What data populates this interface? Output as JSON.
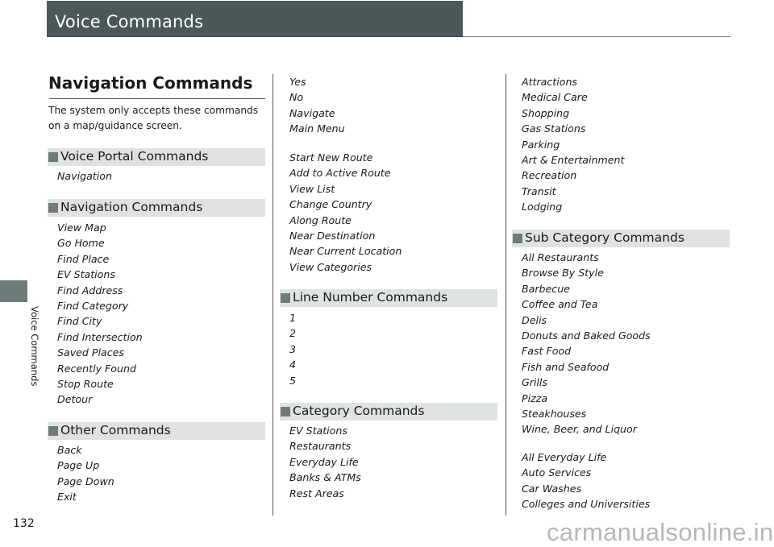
{
  "header": {
    "title": "Voice Commands"
  },
  "side_tab": {
    "label": "Voice Commands"
  },
  "page_number": "132",
  "main": {
    "heading": "Navigation Commands",
    "intro": "The system only accepts these commands on a map/guidance screen."
  },
  "sections": {
    "voice_portal": {
      "title": "Voice Portal Commands",
      "items": [
        "Navigation"
      ]
    },
    "navigation": {
      "title": "Navigation Commands",
      "items": [
        "View Map",
        "Go Home",
        "Find Place",
        "EV Stations",
        "Find Address",
        "Find Category",
        "Find City",
        "Find Intersection",
        "Saved Places",
        "Recently Found",
        "Stop Route",
        "Detour"
      ]
    },
    "other": {
      "title": "Other Commands",
      "items": [
        "Back",
        "Page Up",
        "Page Down",
        "Exit"
      ]
    },
    "navigation_continued": {
      "group1": [
        "Yes",
        "No",
        "Navigate",
        "Main Menu"
      ],
      "group2": [
        "Start New Route",
        "Add to Active Route",
        "View List",
        "Change Country",
        "Along Route",
        "Near Destination",
        "Near Current Location",
        "View Categories"
      ]
    },
    "line_number": {
      "title": "Line Number Commands",
      "items": [
        "1",
        "2",
        "3",
        "4",
        "5"
      ]
    },
    "category": {
      "title": "Category Commands",
      "items": [
        "EV Stations",
        "Restaurants",
        "Everyday Life",
        "Banks & ATMs",
        "Rest Areas"
      ],
      "items_continued": [
        "Attractions",
        "Medical Care",
        "Shopping",
        "Gas Stations",
        "Parking",
        "Art & Entertainment",
        "Recreation",
        "Transit",
        "Lodging"
      ]
    },
    "sub_category": {
      "title": "Sub Category Commands",
      "group1": [
        "All Restaurants",
        "Browse By Style",
        "Barbecue",
        "Coffee and Tea",
        "Delis",
        "Donuts and Baked Goods",
        "Fast Food",
        "Fish and Seafood",
        "Grills",
        "Pizza",
        "Steakhouses",
        "Wine, Beer, and Liquor"
      ],
      "group2": [
        "All Everyday Life",
        "Auto Services",
        "Car Washes",
        "Colleges and Universities"
      ]
    }
  },
  "watermark": "carmanualsonline.info",
  "colors": {
    "header_bg": "#4b5859",
    "section_bg": "#dfe2e2",
    "bullet": "#6e7b7b"
  }
}
